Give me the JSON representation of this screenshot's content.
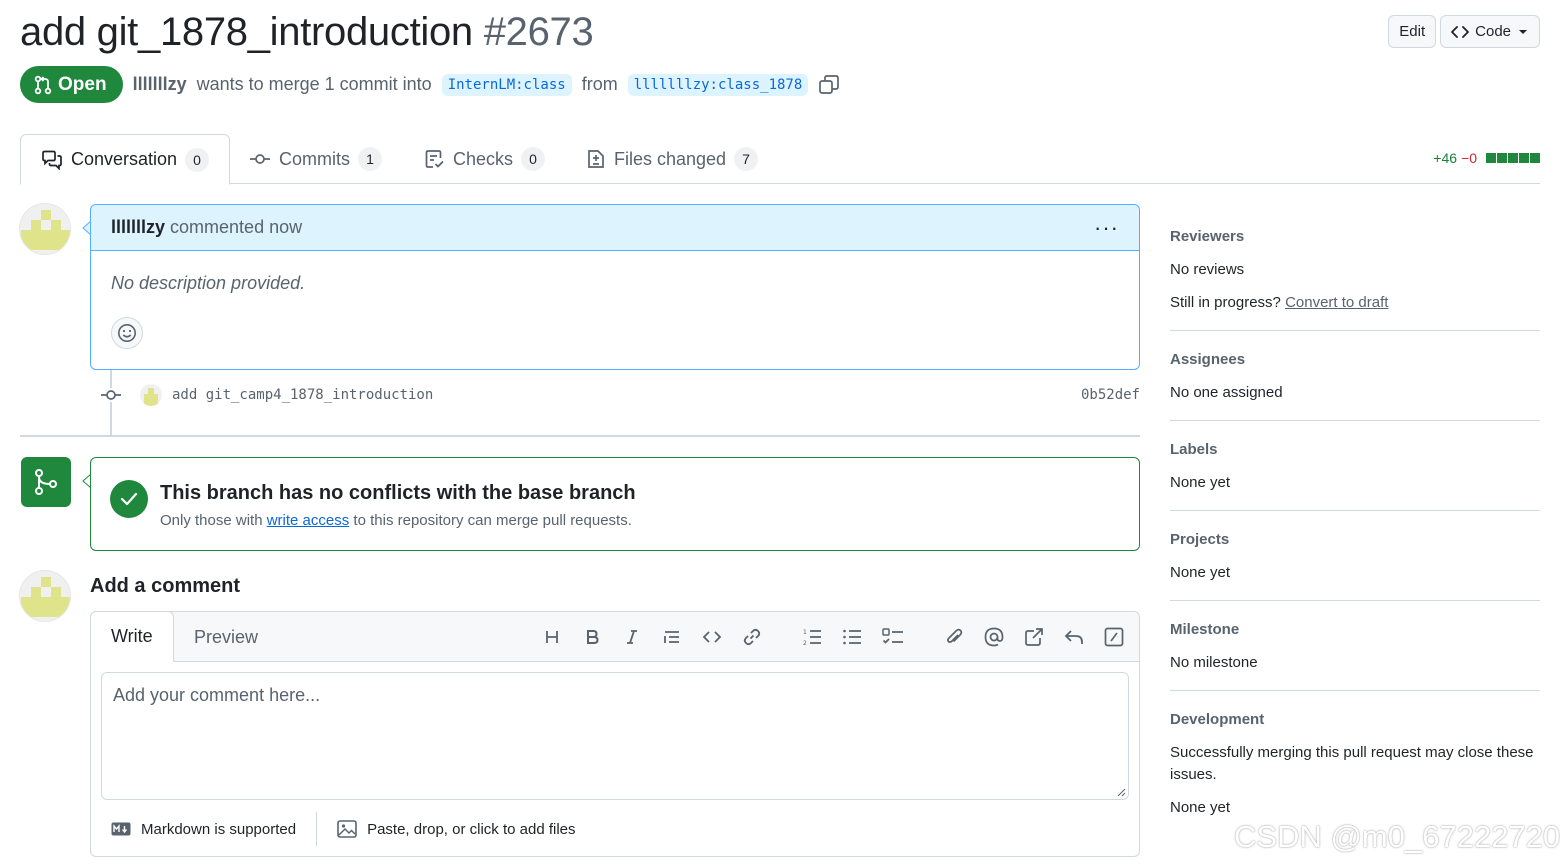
{
  "header": {
    "title": "add git_1878_introduction",
    "number": "#2673",
    "edit_label": "Edit",
    "code_label": "Code"
  },
  "state": {
    "badge": "Open",
    "author": "lllllllzy",
    "text": "wants to merge 1 commit into",
    "base_branch": "InternLM:class",
    "from": "from",
    "head_branch": "lllllllzy:class_1878"
  },
  "tabs": [
    {
      "label": "Conversation",
      "count": "0"
    },
    {
      "label": "Commits",
      "count": "1"
    },
    {
      "label": "Checks",
      "count": "0"
    },
    {
      "label": "Files changed",
      "count": "7"
    }
  ],
  "diffstat": {
    "additions": "+46",
    "deletions": "−0"
  },
  "comment": {
    "author": "lllllllzy",
    "time": "commented now",
    "body": "No description provided."
  },
  "commit": {
    "message": "add git_camp4_1878_introduction",
    "sha": "0b52def"
  },
  "merge": {
    "title": "This branch has no conflicts with the base branch",
    "sub_prefix": "Only those with",
    "sub_link": "write access",
    "sub_suffix": "to this repository can merge pull requests."
  },
  "add_comment": {
    "title": "Add a comment",
    "write_tab": "Write",
    "preview_tab": "Preview",
    "placeholder": "Add your comment here...",
    "markdown_note": "Markdown is supported",
    "attach_note": "Paste, drop, or click to add files"
  },
  "sidebar": {
    "reviewers": {
      "heading": "Reviewers",
      "value": "No reviews",
      "draft_prefix": "Still in progress?",
      "draft_link": "Convert to draft"
    },
    "assignees": {
      "heading": "Assignees",
      "value": "No one assigned"
    },
    "labels": {
      "heading": "Labels",
      "value": "None yet"
    },
    "projects": {
      "heading": "Projects",
      "value": "None yet"
    },
    "milestone": {
      "heading": "Milestone",
      "value": "No milestone"
    },
    "development": {
      "heading": "Development",
      "value": "Successfully merging this pull request may close these issues.",
      "none": "None yet"
    }
  },
  "watermark": "CSDN @m0_67222720",
  "colors": {
    "accent_green": "#1f883d",
    "link_blue": "#0969da",
    "comment_header_bg": "#ddf4ff"
  }
}
